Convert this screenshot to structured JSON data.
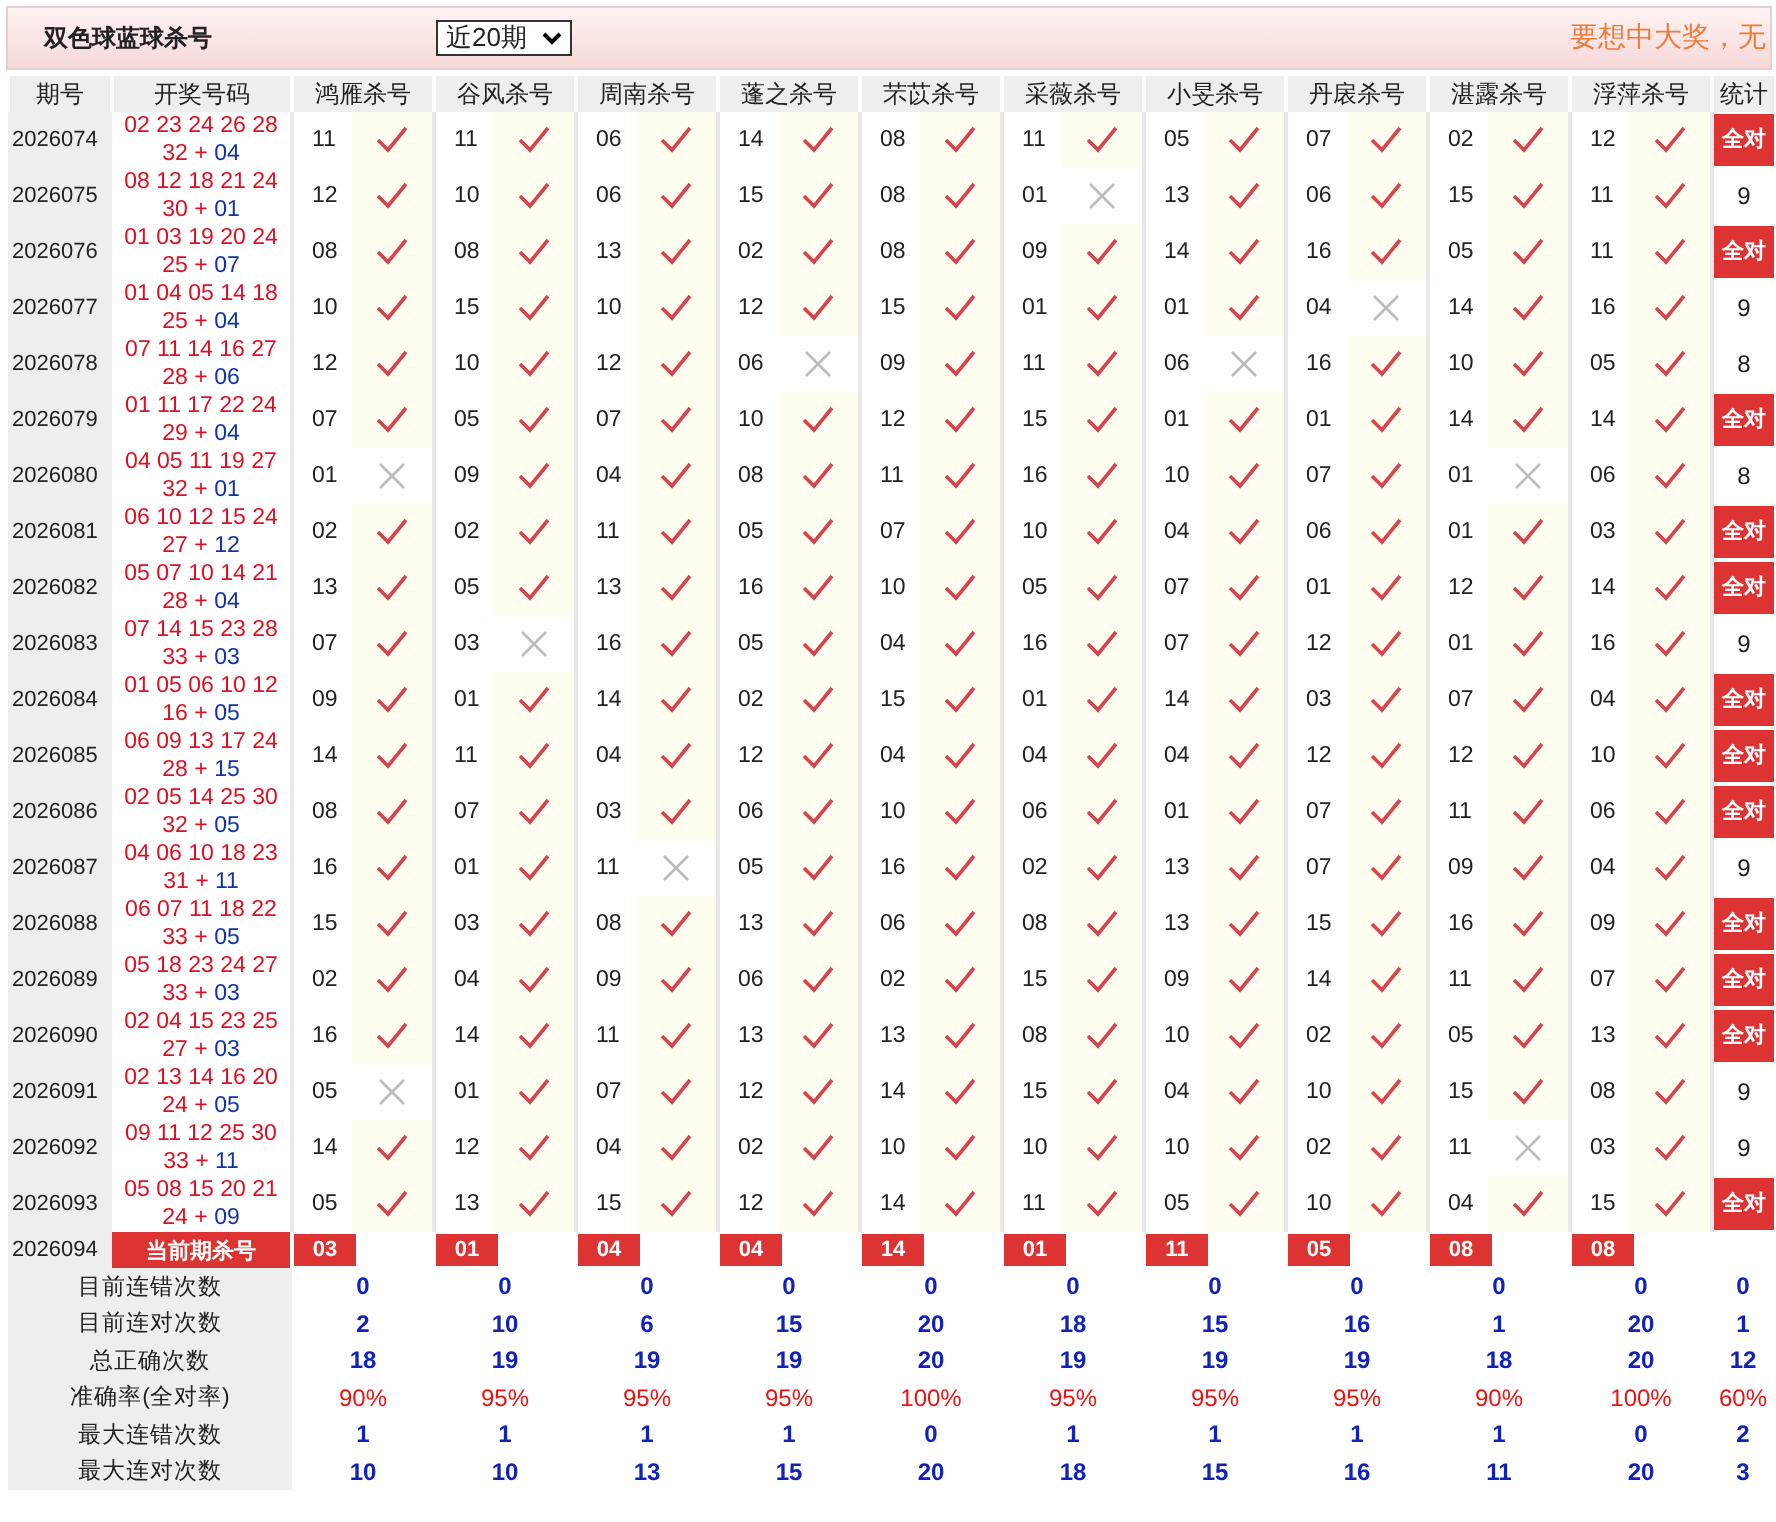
{
  "header": {
    "title": "双色球蓝球杀号",
    "period_select": {
      "value": "近20期"
    },
    "slogan": "要想中大奖，无"
  },
  "columns": {
    "period": "期号",
    "draw": "开奖号码",
    "predictors": [
      "鸿雁杀号",
      "谷风杀号",
      "周南杀号",
      "蓬之杀号",
      "芣苡杀号",
      "采薇杀号",
      "小旻杀号",
      "丹扆杀号",
      "湛露杀号",
      "浮萍杀号"
    ],
    "stat": "统计"
  },
  "rows": [
    {
      "period": "2026074",
      "red": [
        "02",
        "23",
        "24",
        "26",
        "28",
        "32"
      ],
      "joiner": "+",
      "blue": "04",
      "kills": [
        {
          "n": "11",
          "hit": true
        },
        {
          "n": "11",
          "hit": true
        },
        {
          "n": "06",
          "hit": true
        },
        {
          "n": "14",
          "hit": true
        },
        {
          "n": "08",
          "hit": true
        },
        {
          "n": "11",
          "hit": true
        },
        {
          "n": "05",
          "hit": true
        },
        {
          "n": "07",
          "hit": true
        },
        {
          "n": "02",
          "hit": true
        },
        {
          "n": "12",
          "hit": true
        }
      ],
      "stat": "全对",
      "all_correct": true
    },
    {
      "period": "2026075",
      "red": [
        "08",
        "12",
        "18",
        "21",
        "24",
        "30"
      ],
      "joiner": "+",
      "blue": "01",
      "kills": [
        {
          "n": "12",
          "hit": true
        },
        {
          "n": "10",
          "hit": true
        },
        {
          "n": "06",
          "hit": true
        },
        {
          "n": "15",
          "hit": true
        },
        {
          "n": "08",
          "hit": true
        },
        {
          "n": "01",
          "hit": false
        },
        {
          "n": "13",
          "hit": true
        },
        {
          "n": "06",
          "hit": true
        },
        {
          "n": "15",
          "hit": true
        },
        {
          "n": "11",
          "hit": true
        }
      ],
      "stat": "9",
      "all_correct": false
    },
    {
      "period": "2026076",
      "red": [
        "01",
        "03",
        "19",
        "20",
        "24",
        "25"
      ],
      "joiner": "+",
      "blue": "07",
      "kills": [
        {
          "n": "08",
          "hit": true
        },
        {
          "n": "08",
          "hit": true
        },
        {
          "n": "13",
          "hit": true
        },
        {
          "n": "02",
          "hit": true
        },
        {
          "n": "08",
          "hit": true
        },
        {
          "n": "09",
          "hit": true
        },
        {
          "n": "14",
          "hit": true
        },
        {
          "n": "16",
          "hit": true
        },
        {
          "n": "05",
          "hit": true
        },
        {
          "n": "11",
          "hit": true
        }
      ],
      "stat": "全对",
      "all_correct": true
    },
    {
      "period": "2026077",
      "red": [
        "01",
        "04",
        "05",
        "14",
        "18",
        "25"
      ],
      "joiner": "+",
      "blue": "04",
      "kills": [
        {
          "n": "10",
          "hit": true
        },
        {
          "n": "15",
          "hit": true
        },
        {
          "n": "10",
          "hit": true
        },
        {
          "n": "12",
          "hit": true
        },
        {
          "n": "15",
          "hit": true
        },
        {
          "n": "01",
          "hit": true
        },
        {
          "n": "01",
          "hit": true
        },
        {
          "n": "04",
          "hit": false
        },
        {
          "n": "14",
          "hit": true
        },
        {
          "n": "16",
          "hit": true
        }
      ],
      "stat": "9",
      "all_correct": false
    },
    {
      "period": "2026078",
      "red": [
        "07",
        "11",
        "14",
        "16",
        "27",
        "28"
      ],
      "joiner": "+",
      "blue": "06",
      "kills": [
        {
          "n": "12",
          "hit": true
        },
        {
          "n": "10",
          "hit": true
        },
        {
          "n": "12",
          "hit": true
        },
        {
          "n": "06",
          "hit": false
        },
        {
          "n": "09",
          "hit": true
        },
        {
          "n": "11",
          "hit": true
        },
        {
          "n": "06",
          "hit": false
        },
        {
          "n": "16",
          "hit": true
        },
        {
          "n": "10",
          "hit": true
        },
        {
          "n": "05",
          "hit": true
        }
      ],
      "stat": "8",
      "all_correct": false
    },
    {
      "period": "2026079",
      "red": [
        "01",
        "11",
        "17",
        "22",
        "24",
        "29"
      ],
      "joiner": "+",
      "blue": "04",
      "kills": [
        {
          "n": "07",
          "hit": true
        },
        {
          "n": "05",
          "hit": true
        },
        {
          "n": "07",
          "hit": true
        },
        {
          "n": "10",
          "hit": true
        },
        {
          "n": "12",
          "hit": true
        },
        {
          "n": "15",
          "hit": true
        },
        {
          "n": "01",
          "hit": true
        },
        {
          "n": "01",
          "hit": true
        },
        {
          "n": "14",
          "hit": true
        },
        {
          "n": "14",
          "hit": true
        }
      ],
      "stat": "全对",
      "all_correct": true
    },
    {
      "period": "2026080",
      "red": [
        "04",
        "05",
        "11",
        "19",
        "27",
        "32"
      ],
      "joiner": "+",
      "blue": "01",
      "kills": [
        {
          "n": "01",
          "hit": false
        },
        {
          "n": "09",
          "hit": true
        },
        {
          "n": "04",
          "hit": true
        },
        {
          "n": "08",
          "hit": true
        },
        {
          "n": "11",
          "hit": true
        },
        {
          "n": "16",
          "hit": true
        },
        {
          "n": "10",
          "hit": true
        },
        {
          "n": "07",
          "hit": true
        },
        {
          "n": "01",
          "hit": false
        },
        {
          "n": "06",
          "hit": true
        }
      ],
      "stat": "8",
      "all_correct": false
    },
    {
      "period": "2026081",
      "red": [
        "06",
        "10",
        "12",
        "15",
        "24",
        "27"
      ],
      "joiner": "+",
      "blue": "12",
      "kills": [
        {
          "n": "02",
          "hit": true
        },
        {
          "n": "02",
          "hit": true
        },
        {
          "n": "11",
          "hit": true
        },
        {
          "n": "05",
          "hit": true
        },
        {
          "n": "07",
          "hit": true
        },
        {
          "n": "10",
          "hit": true
        },
        {
          "n": "04",
          "hit": true
        },
        {
          "n": "06",
          "hit": true
        },
        {
          "n": "01",
          "hit": true
        },
        {
          "n": "03",
          "hit": true
        }
      ],
      "stat": "全对",
      "all_correct": true
    },
    {
      "period": "2026082",
      "red": [
        "05",
        "07",
        "10",
        "14",
        "21",
        "28"
      ],
      "joiner": "+",
      "blue": "04",
      "kills": [
        {
          "n": "13",
          "hit": true
        },
        {
          "n": "05",
          "hit": true
        },
        {
          "n": "13",
          "hit": true
        },
        {
          "n": "16",
          "hit": true
        },
        {
          "n": "10",
          "hit": true
        },
        {
          "n": "05",
          "hit": true
        },
        {
          "n": "07",
          "hit": true
        },
        {
          "n": "01",
          "hit": true
        },
        {
          "n": "12",
          "hit": true
        },
        {
          "n": "14",
          "hit": true
        }
      ],
      "stat": "全对",
      "all_correct": true
    },
    {
      "period": "2026083",
      "red": [
        "07",
        "14",
        "15",
        "23",
        "28",
        "33"
      ],
      "joiner": "+",
      "blue": "03",
      "kills": [
        {
          "n": "07",
          "hit": true
        },
        {
          "n": "03",
          "hit": false
        },
        {
          "n": "16",
          "hit": true
        },
        {
          "n": "05",
          "hit": true
        },
        {
          "n": "04",
          "hit": true
        },
        {
          "n": "16",
          "hit": true
        },
        {
          "n": "07",
          "hit": true
        },
        {
          "n": "12",
          "hit": true
        },
        {
          "n": "01",
          "hit": true
        },
        {
          "n": "16",
          "hit": true
        }
      ],
      "stat": "9",
      "all_correct": false
    },
    {
      "period": "2026084",
      "red": [
        "01",
        "05",
        "06",
        "10",
        "12",
        "16"
      ],
      "joiner": "+",
      "blue": "05",
      "kills": [
        {
          "n": "09",
          "hit": true
        },
        {
          "n": "01",
          "hit": true
        },
        {
          "n": "14",
          "hit": true
        },
        {
          "n": "02",
          "hit": true
        },
        {
          "n": "15",
          "hit": true
        },
        {
          "n": "01",
          "hit": true
        },
        {
          "n": "14",
          "hit": true
        },
        {
          "n": "03",
          "hit": true
        },
        {
          "n": "07",
          "hit": true
        },
        {
          "n": "04",
          "hit": true
        }
      ],
      "stat": "全对",
      "all_correct": true
    },
    {
      "period": "2026085",
      "red": [
        "06",
        "09",
        "13",
        "17",
        "24",
        "28"
      ],
      "joiner": "+",
      "blue": "15",
      "kills": [
        {
          "n": "14",
          "hit": true
        },
        {
          "n": "11",
          "hit": true
        },
        {
          "n": "04",
          "hit": true
        },
        {
          "n": "12",
          "hit": true
        },
        {
          "n": "04",
          "hit": true
        },
        {
          "n": "04",
          "hit": true
        },
        {
          "n": "04",
          "hit": true
        },
        {
          "n": "12",
          "hit": true
        },
        {
          "n": "12",
          "hit": true
        },
        {
          "n": "10",
          "hit": true
        }
      ],
      "stat": "全对",
      "all_correct": true
    },
    {
      "period": "2026086",
      "red": [
        "02",
        "05",
        "14",
        "25",
        "30",
        "32"
      ],
      "joiner": "+",
      "blue": "05",
      "kills": [
        {
          "n": "08",
          "hit": true
        },
        {
          "n": "07",
          "hit": true
        },
        {
          "n": "03",
          "hit": true
        },
        {
          "n": "06",
          "hit": true
        },
        {
          "n": "10",
          "hit": true
        },
        {
          "n": "06",
          "hit": true
        },
        {
          "n": "01",
          "hit": true
        },
        {
          "n": "07",
          "hit": true
        },
        {
          "n": "11",
          "hit": true
        },
        {
          "n": "06",
          "hit": true
        }
      ],
      "stat": "全对",
      "all_correct": true
    },
    {
      "period": "2026087",
      "red": [
        "04",
        "06",
        "10",
        "18",
        "23",
        "31"
      ],
      "joiner": "+",
      "blue": "11",
      "kills": [
        {
          "n": "16",
          "hit": true
        },
        {
          "n": "01",
          "hit": true
        },
        {
          "n": "11",
          "hit": false
        },
        {
          "n": "05",
          "hit": true
        },
        {
          "n": "16",
          "hit": true
        },
        {
          "n": "02",
          "hit": true
        },
        {
          "n": "13",
          "hit": true
        },
        {
          "n": "07",
          "hit": true
        },
        {
          "n": "09",
          "hit": true
        },
        {
          "n": "04",
          "hit": true
        }
      ],
      "stat": "9",
      "all_correct": false
    },
    {
      "period": "2026088",
      "red": [
        "06",
        "07",
        "11",
        "18",
        "22",
        "33"
      ],
      "joiner": "+",
      "blue": "05",
      "kills": [
        {
          "n": "15",
          "hit": true
        },
        {
          "n": "03",
          "hit": true
        },
        {
          "n": "08",
          "hit": true
        },
        {
          "n": "13",
          "hit": true
        },
        {
          "n": "06",
          "hit": true
        },
        {
          "n": "08",
          "hit": true
        },
        {
          "n": "13",
          "hit": true
        },
        {
          "n": "15",
          "hit": true
        },
        {
          "n": "16",
          "hit": true
        },
        {
          "n": "09",
          "hit": true
        }
      ],
      "stat": "全对",
      "all_correct": true
    },
    {
      "period": "2026089",
      "red": [
        "05",
        "18",
        "23",
        "24",
        "27",
        "33"
      ],
      "joiner": "+",
      "blue": "03",
      "kills": [
        {
          "n": "02",
          "hit": true
        },
        {
          "n": "04",
          "hit": true
        },
        {
          "n": "09",
          "hit": true
        },
        {
          "n": "06",
          "hit": true
        },
        {
          "n": "02",
          "hit": true
        },
        {
          "n": "15",
          "hit": true
        },
        {
          "n": "09",
          "hit": true
        },
        {
          "n": "14",
          "hit": true
        },
        {
          "n": "11",
          "hit": true
        },
        {
          "n": "07",
          "hit": true
        }
      ],
      "stat": "全对",
      "all_correct": true
    },
    {
      "period": "2026090",
      "red": [
        "02",
        "04",
        "15",
        "23",
        "25",
        "27"
      ],
      "joiner": "+",
      "blue": "03",
      "kills": [
        {
          "n": "16",
          "hit": true
        },
        {
          "n": "14",
          "hit": true
        },
        {
          "n": "11",
          "hit": true
        },
        {
          "n": "13",
          "hit": true
        },
        {
          "n": "13",
          "hit": true
        },
        {
          "n": "08",
          "hit": true
        },
        {
          "n": "10",
          "hit": true
        },
        {
          "n": "02",
          "hit": true
        },
        {
          "n": "05",
          "hit": true
        },
        {
          "n": "13",
          "hit": true
        }
      ],
      "stat": "全对",
      "all_correct": true
    },
    {
      "period": "2026091",
      "red": [
        "02",
        "13",
        "14",
        "16",
        "20",
        "24"
      ],
      "joiner": "+",
      "blue": "05",
      "kills": [
        {
          "n": "05",
          "hit": false
        },
        {
          "n": "01",
          "hit": true
        },
        {
          "n": "07",
          "hit": true
        },
        {
          "n": "12",
          "hit": true
        },
        {
          "n": "14",
          "hit": true
        },
        {
          "n": "15",
          "hit": true
        },
        {
          "n": "04",
          "hit": true
        },
        {
          "n": "10",
          "hit": true
        },
        {
          "n": "15",
          "hit": true
        },
        {
          "n": "08",
          "hit": true
        }
      ],
      "stat": "9",
      "all_correct": false
    },
    {
      "period": "2026092",
      "red": [
        "09",
        "11",
        "12",
        "25",
        "30",
        "33"
      ],
      "joiner": "+",
      "blue": "11",
      "kills": [
        {
          "n": "14",
          "hit": true
        },
        {
          "n": "12",
          "hit": true
        },
        {
          "n": "04",
          "hit": true
        },
        {
          "n": "02",
          "hit": true
        },
        {
          "n": "10",
          "hit": true
        },
        {
          "n": "10",
          "hit": true
        },
        {
          "n": "10",
          "hit": true
        },
        {
          "n": "02",
          "hit": true
        },
        {
          "n": "11",
          "hit": false
        },
        {
          "n": "03",
          "hit": true
        }
      ],
      "stat": "9",
      "all_correct": false
    },
    {
      "period": "2026093",
      "red": [
        "05",
        "08",
        "15",
        "20",
        "21",
        "24"
      ],
      "joiner": "+",
      "blue": "09",
      "kills": [
        {
          "n": "05",
          "hit": true
        },
        {
          "n": "13",
          "hit": true
        },
        {
          "n": "15",
          "hit": true
        },
        {
          "n": "12",
          "hit": true
        },
        {
          "n": "14",
          "hit": true
        },
        {
          "n": "11",
          "hit": true
        },
        {
          "n": "05",
          "hit": true
        },
        {
          "n": "10",
          "hit": true
        },
        {
          "n": "04",
          "hit": true
        },
        {
          "n": "15",
          "hit": true
        }
      ],
      "stat": "全对",
      "all_correct": true
    }
  ],
  "current": {
    "period": "2026094",
    "label": "当前期杀号",
    "kills": [
      "03",
      "01",
      "04",
      "04",
      "14",
      "01",
      "11",
      "05",
      "08",
      "08"
    ]
  },
  "stats": [
    {
      "label": "目前连错次数",
      "kind": "count",
      "values": [
        "0",
        "0",
        "0",
        "0",
        "0",
        "0",
        "0",
        "0",
        "0",
        "0",
        "0"
      ]
    },
    {
      "label": "目前连对次数",
      "kind": "count",
      "values": [
        "2",
        "10",
        "6",
        "15",
        "20",
        "18",
        "15",
        "16",
        "1",
        "20",
        "1"
      ]
    },
    {
      "label": "总正确次数",
      "kind": "count",
      "values": [
        "18",
        "19",
        "19",
        "19",
        "20",
        "19",
        "19",
        "19",
        "18",
        "20",
        "12"
      ]
    },
    {
      "label": "准确率(全对率)",
      "kind": "rate",
      "values": [
        "90%",
        "95%",
        "95%",
        "95%",
        "100%",
        "95%",
        "95%",
        "95%",
        "90%",
        "100%",
        "60%"
      ]
    },
    {
      "label": "最大连错次数",
      "kind": "count",
      "values": [
        "1",
        "1",
        "1",
        "1",
        "0",
        "1",
        "1",
        "1",
        "1",
        "0",
        "2"
      ]
    },
    {
      "label": "最大连对次数",
      "kind": "count",
      "values": [
        "10",
        "10",
        "13",
        "15",
        "20",
        "18",
        "15",
        "16",
        "11",
        "20",
        "3"
      ]
    }
  ]
}
